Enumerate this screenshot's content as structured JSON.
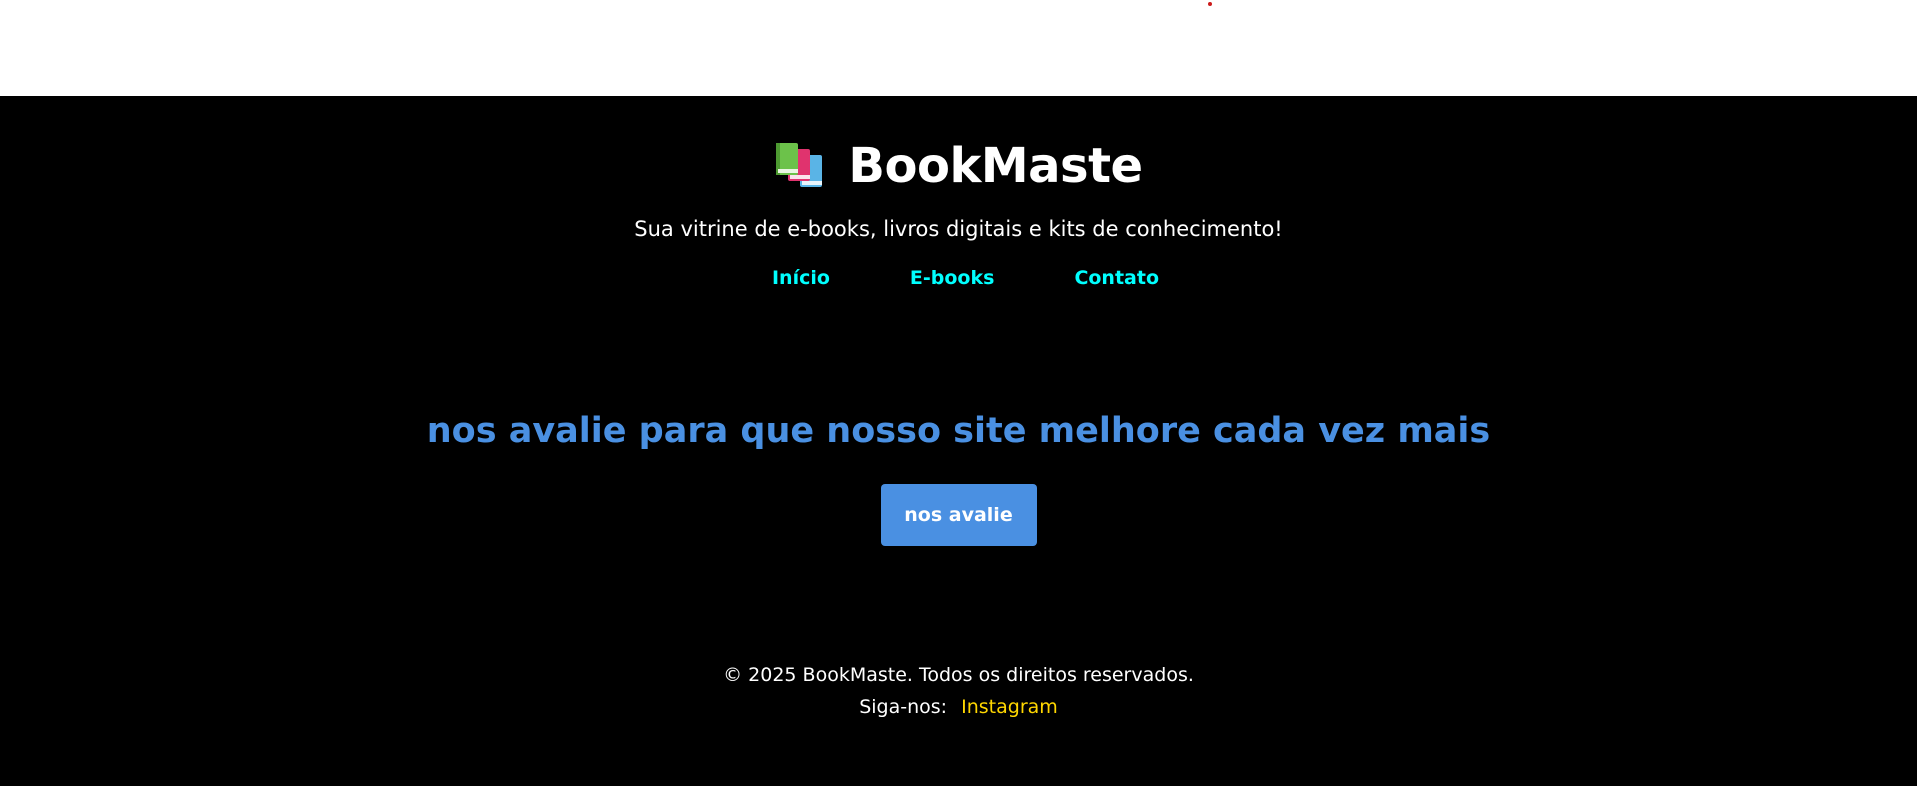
{
  "header": {
    "title": "BookMaste",
    "icon": "books-icon",
    "tagline": "Sua vitrine de e-books, livros digitais e kits de conhecimento!"
  },
  "nav": {
    "items": [
      {
        "label": "Início"
      },
      {
        "label": "E-books"
      },
      {
        "label": "Contato"
      }
    ]
  },
  "review": {
    "heading": "nos avalie para que nosso site melhore cada vez mais",
    "button_label": "nos avalie"
  },
  "footer": {
    "copyright": "© 2025 BookMaste. Todos os direitos reservados.",
    "follow_label": "Siga-nos:",
    "social_link": "Instagram"
  },
  "colors": {
    "background": "#000000",
    "nav_link": "#00ffff",
    "accent_blue": "#4a90e2",
    "social_link": "#ffd700"
  }
}
